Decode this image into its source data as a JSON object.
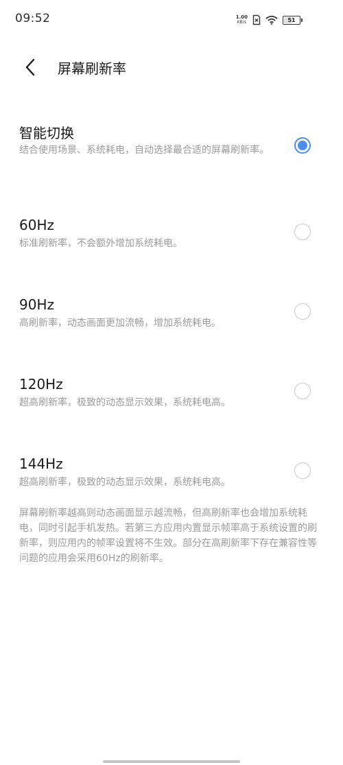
{
  "status_bar": {
    "time": "09:52",
    "net_speed_value": "1.00",
    "net_speed_unit": "KB/s",
    "battery_level": "51",
    "battery_percent": 51,
    "icons": [
      "sim-no-service-icon",
      "wifi-icon",
      "battery-icon"
    ]
  },
  "header": {
    "title": "屏幕刷新率",
    "back_icon": "chevron-left-icon"
  },
  "options": [
    {
      "title": "智能切换",
      "description": "结合使用场景、系统耗电，自动选择最合适的屏幕刷新率。",
      "selected": true
    },
    {
      "title": "60Hz",
      "description": "标准刷新率，不会额外增加系统耗电。",
      "selected": false
    },
    {
      "title": "90Hz",
      "description": "高刷新率，动态画面更加流畅，增加系统耗电。",
      "selected": false
    },
    {
      "title": "120Hz",
      "description": "超高刷新率，极致的动态显示效果，系统耗电高。",
      "selected": false
    },
    {
      "title": "144Hz",
      "description": "超高刷新率，极致的动态显示效果，系统耗电高。",
      "selected": false
    }
  ],
  "footnote": "屏幕刷新率越高则动态画面显示越流畅，但高刷新率也会增加系统耗电，同时引起手机发热。若第三方应用内置显示帧率高于系统设置的刷新率，则应用内的帧率设置将不生效。部分在高刷新率下存在兼容性等问题的应用会采用60Hz的刷新率。",
  "colors": {
    "accent": "#4b8ef0",
    "secondary_text": "#9b9b9b",
    "radio_border": "#c9c9c9"
  }
}
